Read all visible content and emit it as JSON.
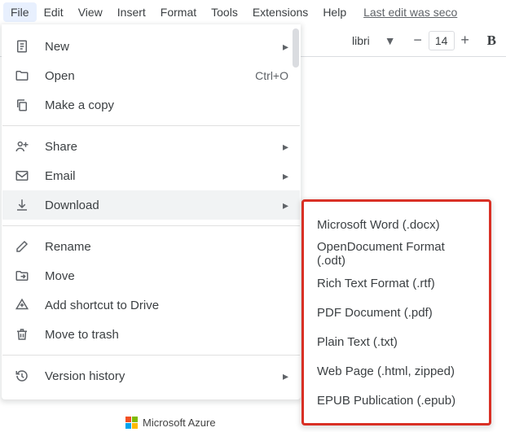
{
  "menubar": {
    "items": [
      "File",
      "Edit",
      "View",
      "Insert",
      "Format",
      "Tools",
      "Extensions",
      "Help"
    ],
    "activeIndex": 0,
    "editStatus": "Last edit was seco"
  },
  "toolbar": {
    "fontName": "libri",
    "fontSize": "14",
    "bold": "B"
  },
  "fileMenu": {
    "items": [
      {
        "icon": "doc-icon",
        "label": "New",
        "submenu": true
      },
      {
        "icon": "folder-icon",
        "label": "Open",
        "shortcut": "Ctrl+O"
      },
      {
        "icon": "copy-icon",
        "label": "Make a copy"
      }
    ],
    "items2": [
      {
        "icon": "share-icon",
        "label": "Share",
        "submenu": true
      },
      {
        "icon": "mail-icon",
        "label": "Email",
        "submenu": true
      },
      {
        "icon": "download-icon",
        "label": "Download",
        "submenu": true,
        "highlight": true
      }
    ],
    "items3": [
      {
        "icon": "rename-icon",
        "label": "Rename"
      },
      {
        "icon": "move-icon",
        "label": "Move"
      },
      {
        "icon": "drive-shortcut-icon",
        "label": "Add shortcut to Drive"
      },
      {
        "icon": "trash-icon",
        "label": "Move to trash"
      }
    ],
    "items4": [
      {
        "icon": "history-icon",
        "label": "Version history",
        "submenu": true
      }
    ]
  },
  "downloadSubmenu": {
    "items": [
      "Microsoft Word (.docx)",
      "OpenDocument Format (.odt)",
      "Rich Text Format (.rtf)",
      "PDF Document (.pdf)",
      "Plain Text (.txt)",
      "Web Page (.html, zipped)",
      "EPUB Publication (.epub)"
    ]
  },
  "footer": {
    "brand": "Microsoft Azure"
  }
}
